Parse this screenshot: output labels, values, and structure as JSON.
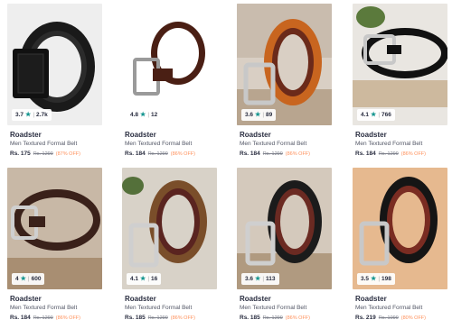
{
  "products": [
    {
      "rating": "3.7",
      "count": "2.7k",
      "brand": "Roadster",
      "name": "Men Textured Formal Belt",
      "price": "Rs. 175",
      "mrp": "Rs. 1299",
      "discount": "(87% OFF)"
    },
    {
      "rating": "4.8",
      "count": "12",
      "brand": "Roadster",
      "name": "Men Textured Formal Belt",
      "price": "Rs. 184",
      "mrp": "Rs. 1299",
      "discount": "(86% OFF)"
    },
    {
      "rating": "3.6",
      "count": "89",
      "brand": "Roadster",
      "name": "Men Textured Formal Belt",
      "price": "Rs. 184",
      "mrp": "Rs. 1299",
      "discount": "(86% OFF)"
    },
    {
      "rating": "4.1",
      "count": "766",
      "brand": "Roadster",
      "name": "Men Textured Formal Belt",
      "price": "Rs. 184",
      "mrp": "Rs. 1299",
      "discount": "(86% OFF)"
    },
    {
      "rating": "4",
      "count": "600",
      "brand": "Roadster",
      "name": "Men Textured Formal Belt",
      "price": "Rs. 184",
      "mrp": "Rs. 1299",
      "discount": "(86% OFF)"
    },
    {
      "rating": "4.1",
      "count": "16",
      "brand": "Roadster",
      "name": "Men Textured Formal Belt",
      "price": "Rs. 185",
      "mrp": "Rs. 1299",
      "discount": "(86% OFF)"
    },
    {
      "rating": "3.6",
      "count": "113",
      "brand": "Roadster",
      "name": "Men Textured Formal Belt",
      "price": "Rs. 185",
      "mrp": "Rs. 1299",
      "discount": "(86% OFF)"
    },
    {
      "rating": "3.5",
      "count": "198",
      "brand": "Roadster",
      "name": "Men Textured Formal Belt",
      "price": "Rs. 219",
      "mrp": "Rs. 1099",
      "discount": "(80% OFF)"
    }
  ],
  "colors": {
    "star": "#14958f",
    "discount": "#ff905a",
    "brand_text": "#282c3f"
  }
}
